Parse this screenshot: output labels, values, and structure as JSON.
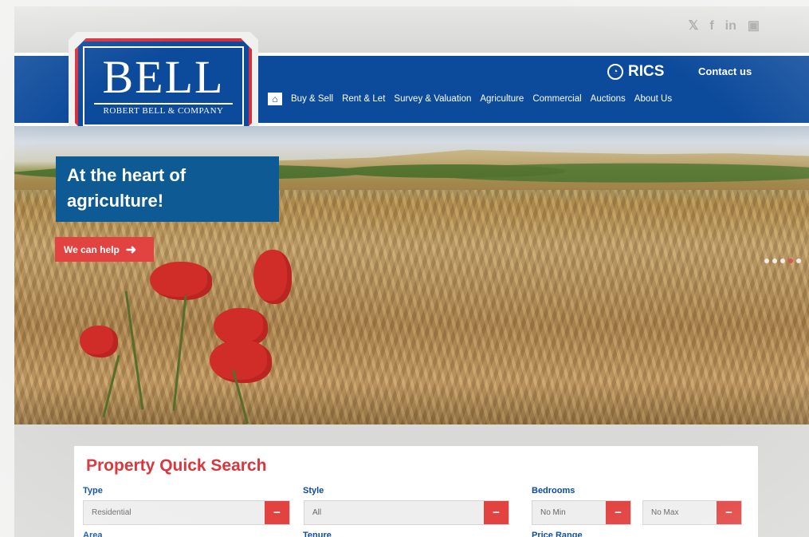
{
  "colors": {
    "primary_blue": "#0c4a9b",
    "accent_red": "#e24340",
    "hero_box": "#0d5a95",
    "background": "#d9d9d7"
  },
  "social_icons": [
    "twitter-icon",
    "facebook-icon",
    "linkedin-icon",
    "youtube-icon"
  ],
  "social_glyphs": {
    "twitter": "𝕏",
    "facebook": "f",
    "linkedin": "in",
    "youtube": "▣"
  },
  "logo": {
    "main": "BELL",
    "sub": "ROBERT BELL & COMPANY"
  },
  "header": {
    "rics_label": "RICS",
    "contact_label": "Contact us",
    "nav": [
      "Buy & Sell",
      "Rent & Let",
      "Survey & Valuation",
      "Agriculture",
      "Commercial",
      "Auctions",
      "About Us"
    ]
  },
  "hero": {
    "title_line1": "At the heart of",
    "title_line2": "agriculture!",
    "cta_label": "We can help",
    "slide_dots": 5,
    "active_dot": 4
  },
  "search": {
    "title": "Property Quick Search",
    "fields": {
      "type_label": "Type",
      "type_value": "Residential",
      "style_label": "Style",
      "style_value": "All",
      "bedrooms_label": "Bedrooms",
      "bedrooms_min": "No Min",
      "bedrooms_max": "No Max",
      "area_label": "Area",
      "tenure_label": "Tenure",
      "price_label": "Price Range"
    }
  }
}
